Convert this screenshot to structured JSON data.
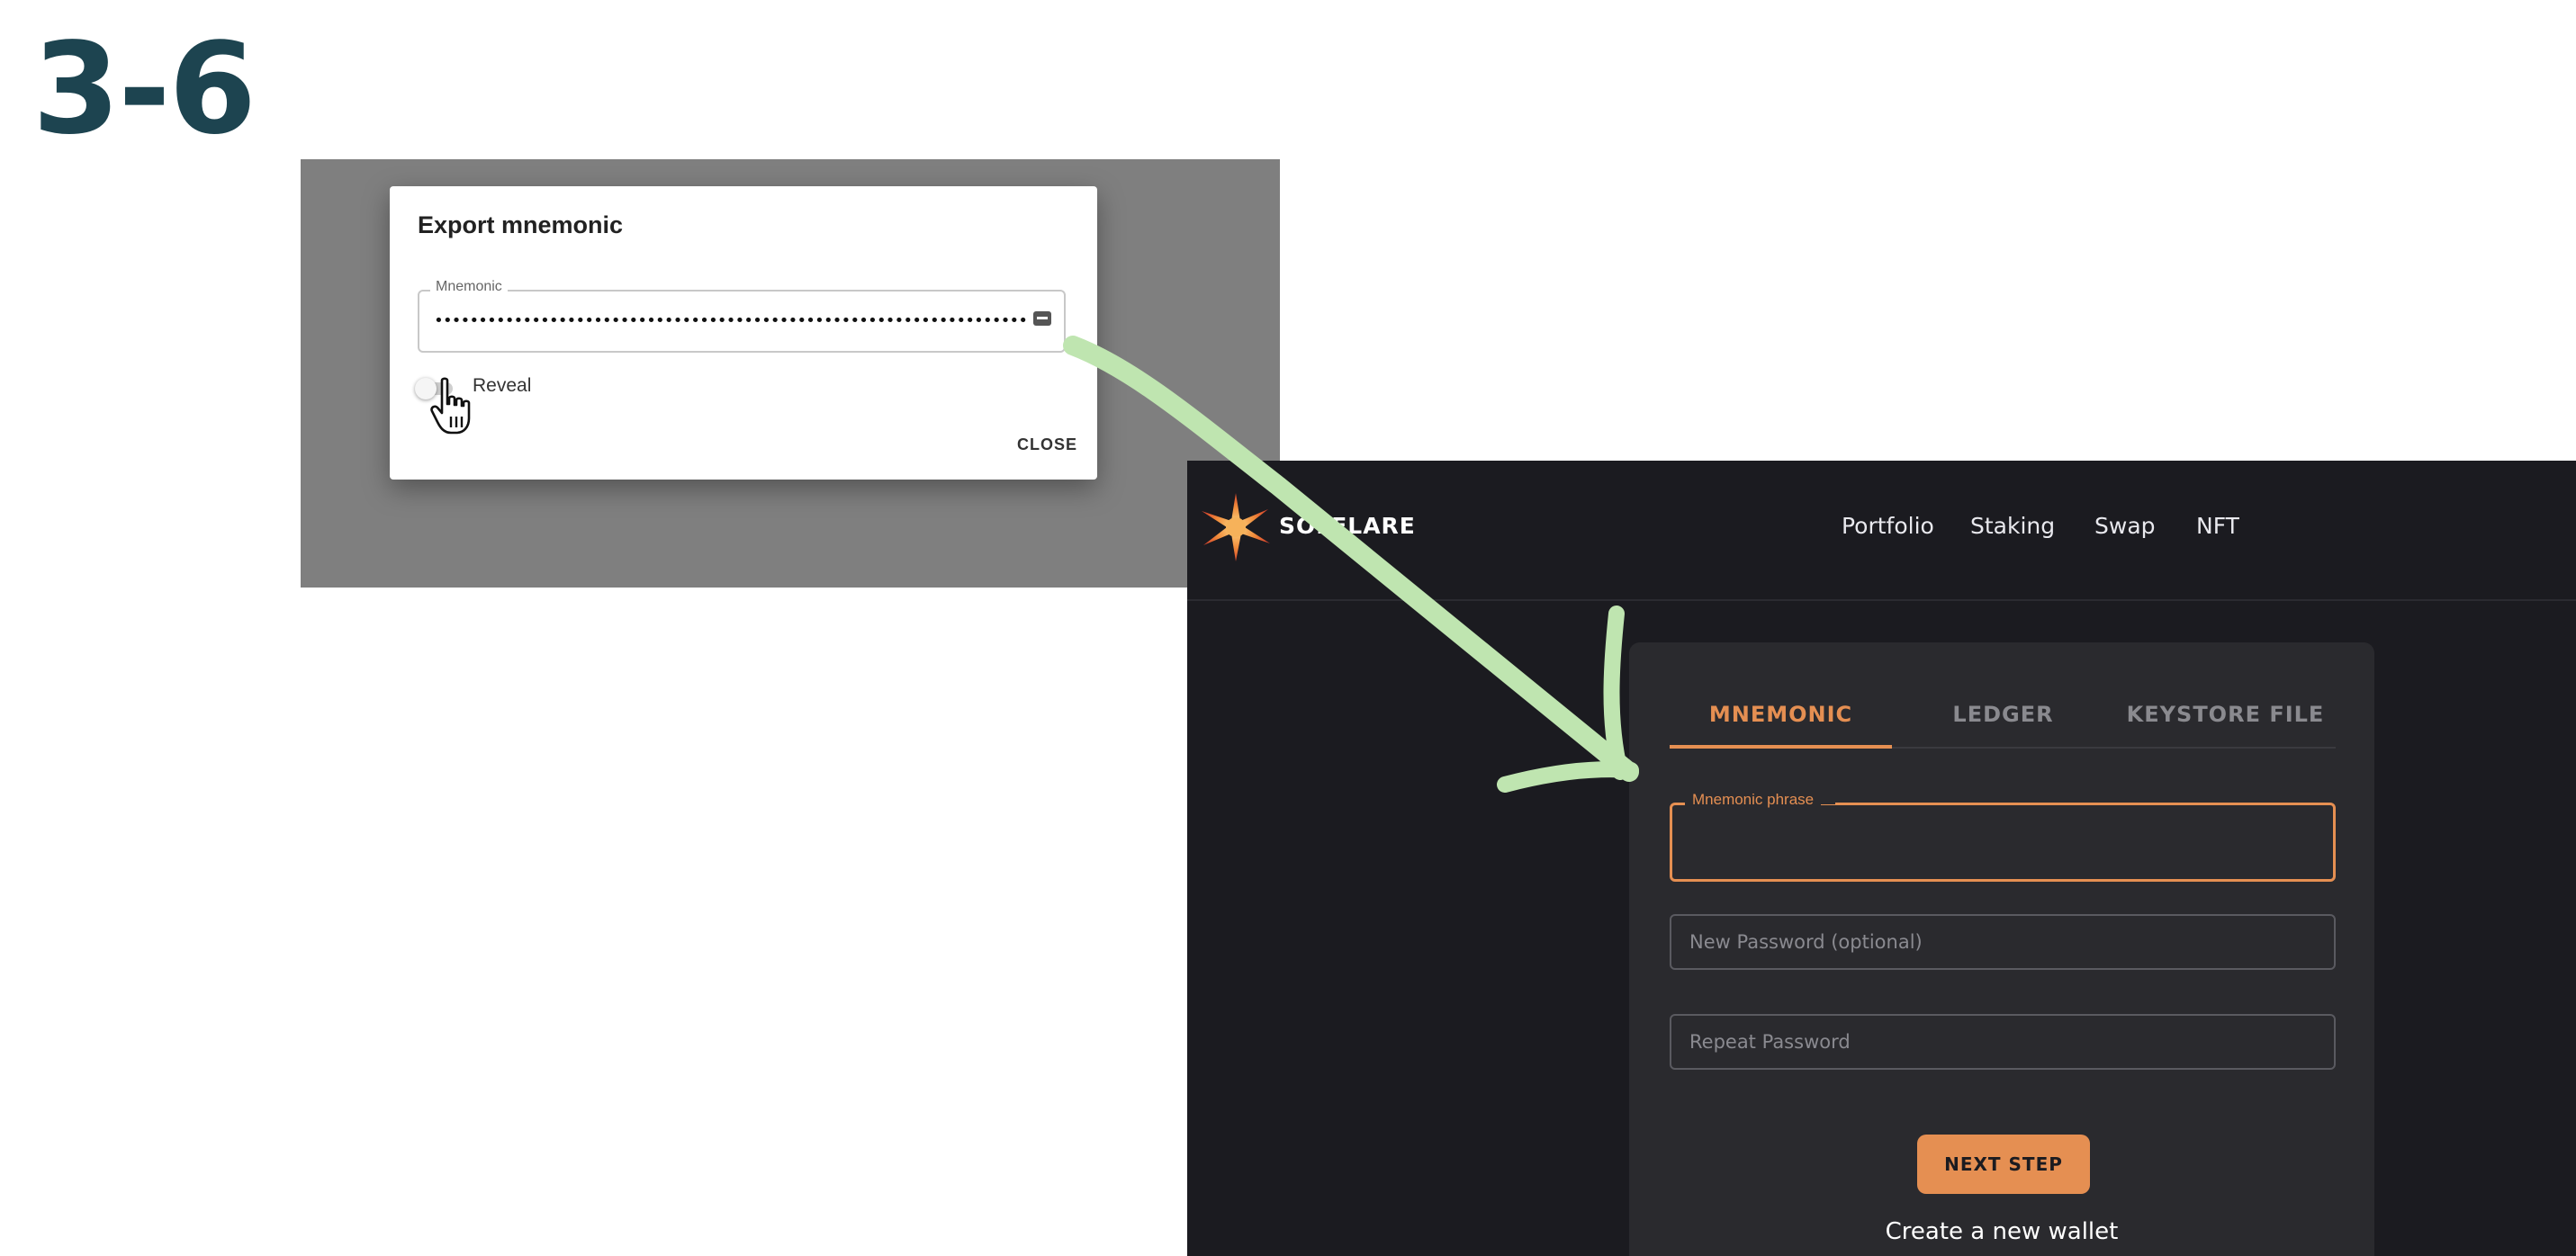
{
  "step_label": "3-6",
  "export_dialog": {
    "title": "Export mnemonic",
    "field_label": "Mnemonic",
    "field_value": "••••••••••••••••••••••••••••••••••••••••••••••••••••••••••••••••••••••••••••••••••••••••••••••••••",
    "reveal_label": "Reveal",
    "reveal_on": false,
    "close_label": "CLOSE"
  },
  "app": {
    "brand": "SOLFLARE",
    "nav": [
      "Portfolio",
      "Staking",
      "Swap",
      "NFT"
    ],
    "tabs": [
      "MNEMONIC",
      "LEDGER",
      "KEYSTORE FILE"
    ],
    "active_tab": "MNEMONIC",
    "mnemonic_label": "Mnemonic phrase",
    "password_placeholder": "New Password (optional)",
    "repeat_placeholder": "Repeat Password",
    "next_button": "NEXT STEP",
    "create_link": "Create a new wallet",
    "accent_color": "#e58f52"
  },
  "icons": {
    "hand": "hand-pointer-icon",
    "key": "password-key-icon",
    "logo": "solflare-logo-icon",
    "arrow": "green-arrow-annotation"
  }
}
